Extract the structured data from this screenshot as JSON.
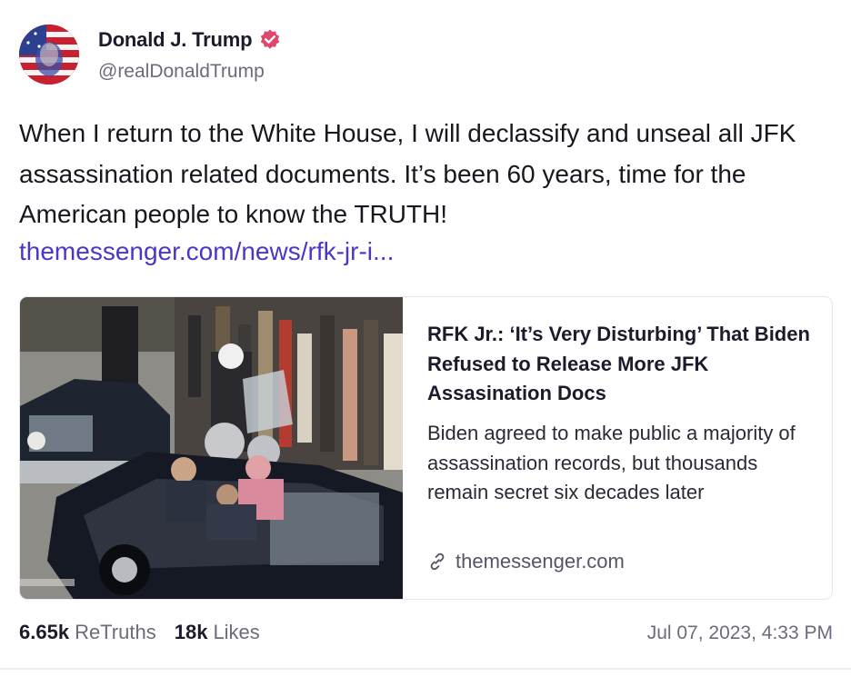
{
  "author": {
    "display_name": "Donald J. Trump",
    "handle": "@realDonaldTrump",
    "verified_icon": "verified-badge-icon",
    "verified_color": "#e0476c"
  },
  "post": {
    "text": "When I return to the White House, I will declassify and unseal all JFK assassination related documents. It’s been 60 years, time for the American people to know the TRUTH!",
    "link_text": "themessenger.com/news/rfk-jr-i...",
    "link_color": "#4a37c9"
  },
  "card": {
    "title": "RFK Jr.: ‘It’s Very Disturbing’ That Biden Refused to Release More JFK Assasination Docs",
    "description": "Biden agreed to make public a majority of assassination records, but thousands remain secret six decades later",
    "domain": "themessenger.com",
    "domain_icon": "link-icon"
  },
  "stats": {
    "retruths_count": "6.65k",
    "retruths_label": "ReTruths",
    "likes_count": "18k",
    "likes_label": "Likes"
  },
  "timestamp": "Jul 07, 2023, 4:33 PM"
}
